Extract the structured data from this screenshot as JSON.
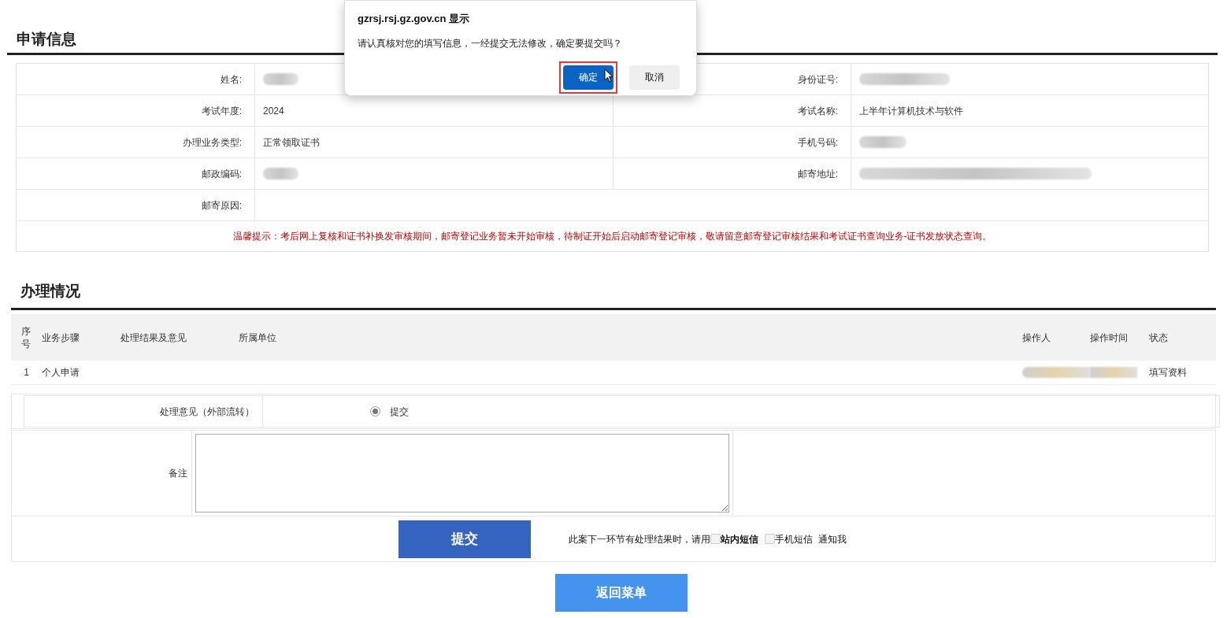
{
  "application_info": {
    "title": "申请信息",
    "rows": [
      [
        {
          "label": "姓名:",
          "kind": "blurred"
        },
        {
          "label": "身份证号:",
          "kind": "blurred"
        }
      ],
      [
        {
          "label": "考试年度:",
          "kind": "text",
          "value": "2024"
        },
        {
          "label": "考试名称:",
          "kind": "text",
          "value": "上半年计算机技术与软件"
        }
      ],
      [
        {
          "label": "办理业务类型:",
          "kind": "text",
          "value": "正常领取证书"
        },
        {
          "label": "手机号码:",
          "kind": "blurred"
        }
      ],
      [
        {
          "label": "邮政编码:",
          "kind": "blurred"
        },
        {
          "label": "邮寄地址:",
          "kind": "blurred"
        }
      ],
      [
        {
          "label": "邮寄原因:",
          "kind": "empty"
        }
      ]
    ],
    "notice": "温馨提示：考后网上复核和证书补换发审核期间，邮寄登记业务暂未开始审核，待制证开始后启动邮寄登记审核，敬请留意邮寄登记审核结果和考试证书查询业务-证书发放状态查询。"
  },
  "processing": {
    "title": "办理情况",
    "columns": [
      "序号",
      "业务步骤",
      "处理结果及意见",
      "所属单位",
      "操作人",
      "操作时间",
      "状态"
    ],
    "rows": [
      {
        "cells": [
          {
            "kind": "text",
            "value": "1"
          },
          {
            "kind": "text",
            "value": "个人申请"
          },
          {
            "kind": "empty"
          },
          {
            "kind": "empty"
          },
          {
            "kind": "blurred"
          },
          {
            "kind": "blurred"
          },
          {
            "kind": "text",
            "value": "填写资料"
          }
        ]
      }
    ]
  },
  "opinion": {
    "label": "处理意见（外部流转）",
    "options": [
      {
        "label": "提交",
        "selected": true
      }
    ]
  },
  "notes": {
    "label": "备注"
  },
  "submit_button": "提交",
  "notify": {
    "prefix": "此案下一环节有处理结果时，请用",
    "options": [
      {
        "label": "站内短信",
        "checked": false,
        "bold": true
      },
      {
        "label": "手机短信",
        "checked": false,
        "bold": false
      }
    ],
    "suffix": "通知我"
  },
  "back_button": "返回菜单",
  "dialog": {
    "title": "gzrsj.rsj.gz.gov.cn 显示",
    "message": "请认真核对您的填写信息，一经提交无法修改，确定要提交吗？",
    "buttons": [
      {
        "label": "确定",
        "primary": true,
        "highlighted": true
      },
      {
        "label": "取消",
        "primary": false,
        "highlighted": false
      }
    ]
  }
}
